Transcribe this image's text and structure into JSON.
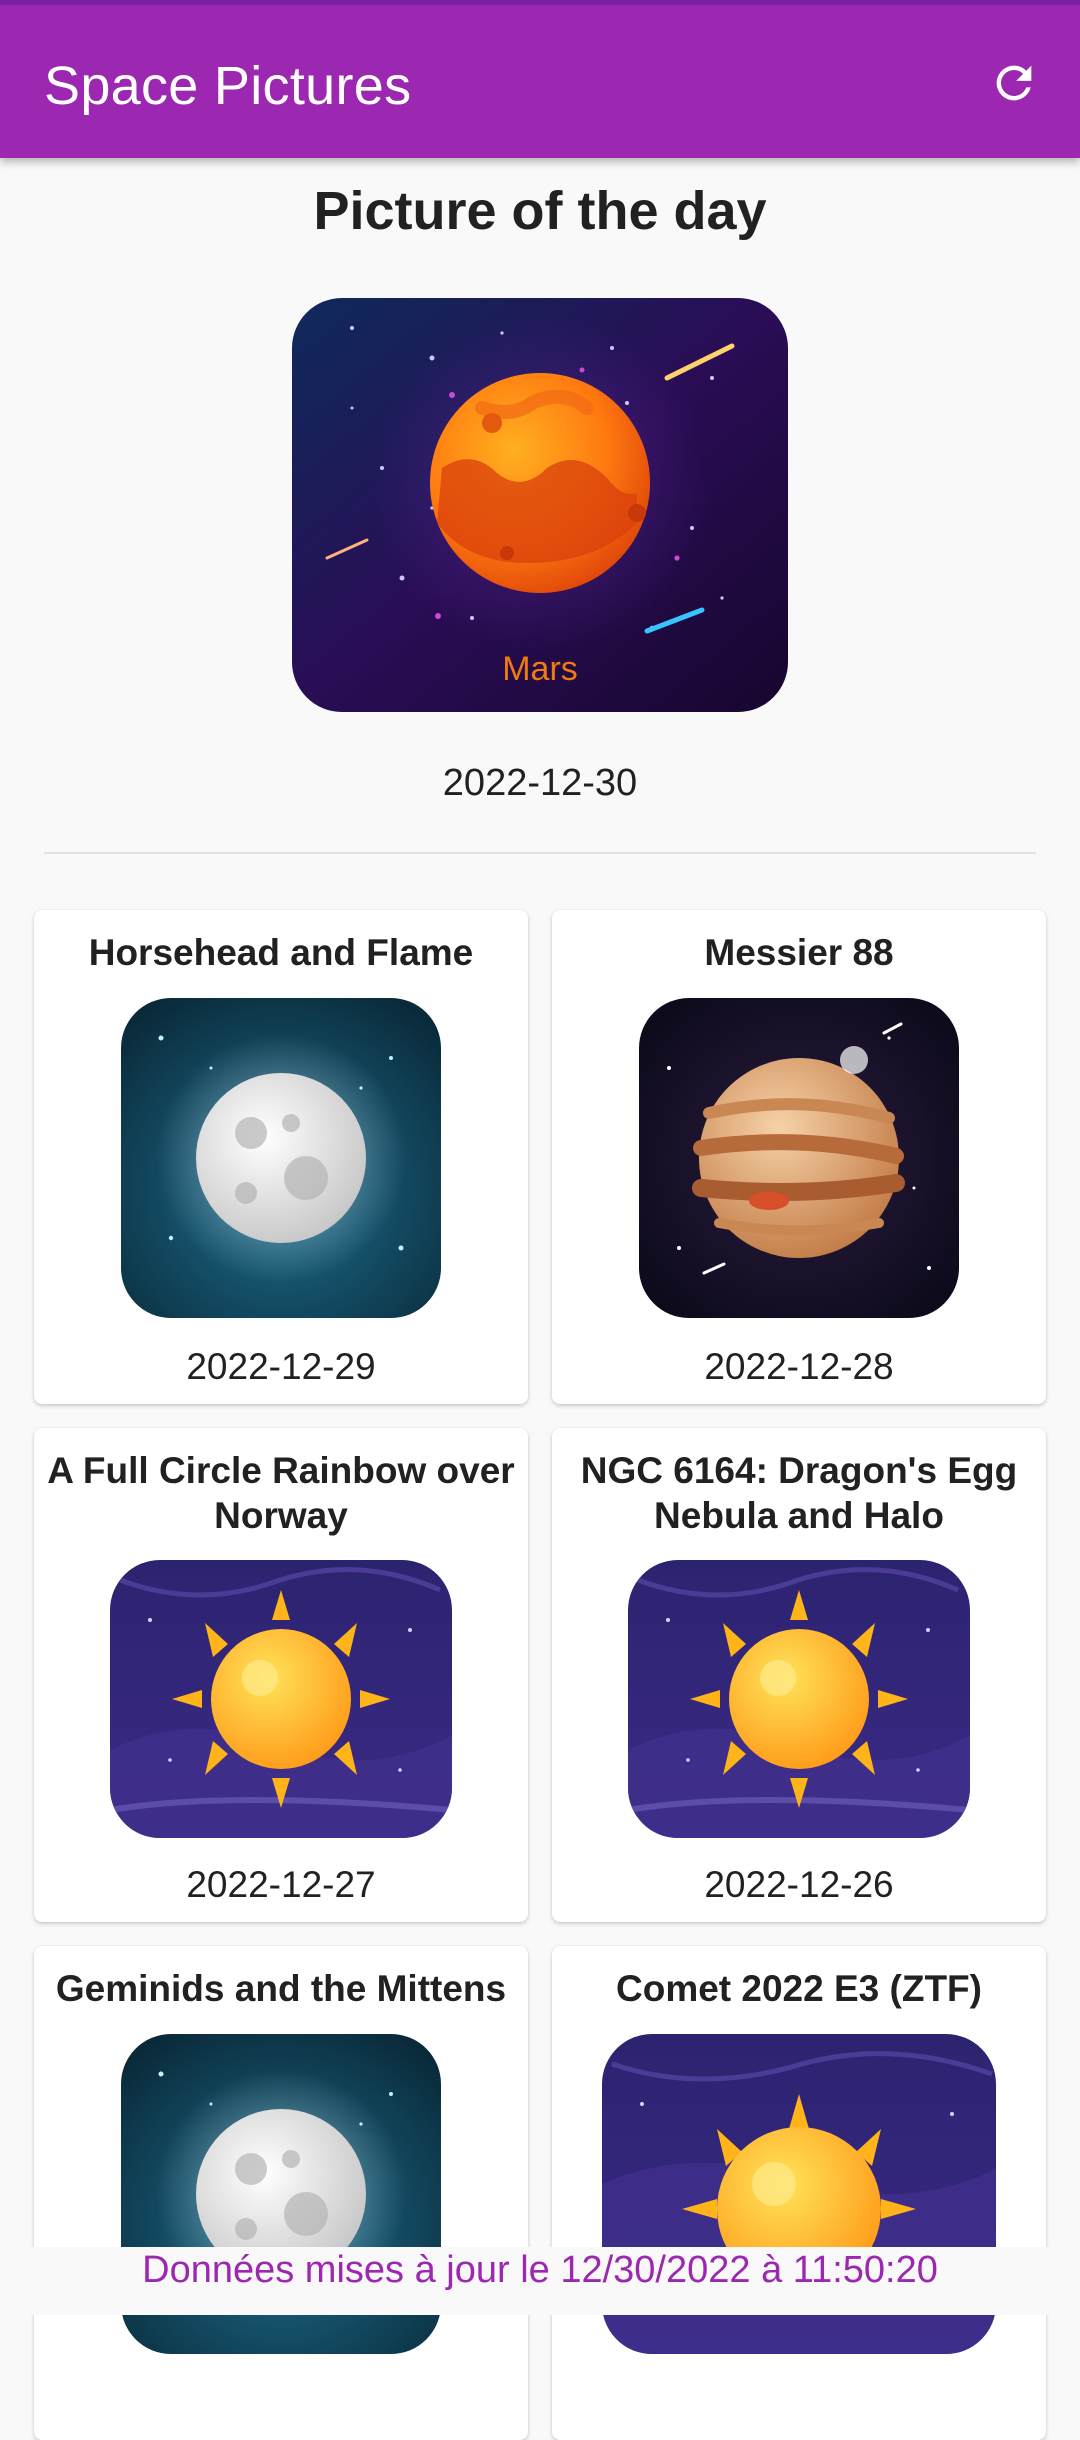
{
  "app_bar": {
    "title": "Space Pictures",
    "refresh_icon": "refresh-icon",
    "color": "#9c27b0"
  },
  "potd": {
    "heading": "Picture of the day",
    "image_label": "Mars",
    "date": "2022-12-30"
  },
  "cards": [
    {
      "title": "Horsehead and Flame",
      "date": "2022-12-29",
      "image": "moon"
    },
    {
      "title": "Messier 88",
      "date": "2022-12-28",
      "image": "jupiter"
    },
    {
      "title": "A Full Circle Rainbow over Norway",
      "date": "2022-12-27",
      "image": "sun"
    },
    {
      "title": "NGC 6164: Dragon's Egg Nebula and Halo",
      "date": "2022-12-26",
      "image": "sun"
    },
    {
      "title": "Geminids and the Mittens",
      "date": "",
      "image": "moon"
    },
    {
      "title": "Comet 2022 E3 (ZTF)",
      "date": "",
      "image": "sun"
    }
  ],
  "footer": {
    "text": "Données mises à jour le 12/30/2022 à 11:50:20"
  }
}
